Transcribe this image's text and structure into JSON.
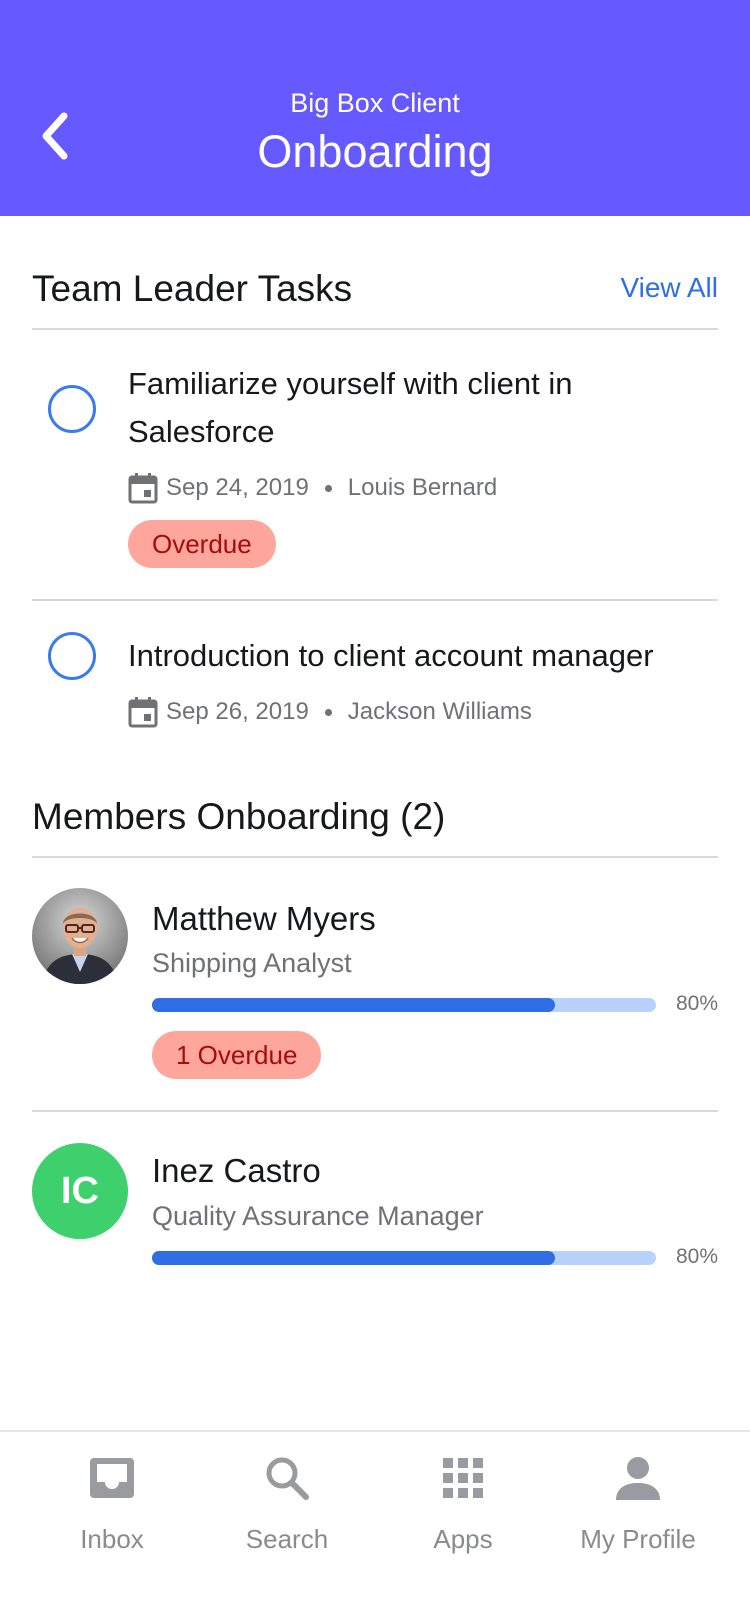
{
  "header": {
    "subtitle": "Big Box Client",
    "title": "Onboarding",
    "back_icon": "chevron-left-icon",
    "background": "#6559ff"
  },
  "tasks_section": {
    "title": "Team Leader Tasks",
    "view_all": "View All",
    "items": [
      {
        "title": "Familiarize yourself with client in Salesforce",
        "date": "Sep 24, 2019",
        "assignee": "Louis Bernard",
        "badge": "Overdue",
        "completed": false
      },
      {
        "title": "Introduction to client account manager",
        "date": "Sep 26, 2019",
        "assignee": "Jackson Williams",
        "completed": false
      }
    ]
  },
  "members_section": {
    "title": "Members Onboarding (2)",
    "members": [
      {
        "name": "Matthew Myers",
        "role": "Shipping Analyst",
        "progress": 0.8,
        "progress_label": "80%",
        "badge": "1 Overdue",
        "avatar": "photo"
      },
      {
        "name": "Inez Castro",
        "role": "Quality Assurance Manager",
        "progress": 0.8,
        "progress_label": "80%",
        "initials": "IC",
        "avatar_color": "#3dd06c"
      }
    ]
  },
  "tabbar": {
    "tabs": [
      {
        "label": "Inbox",
        "icon": "inbox-icon"
      },
      {
        "label": "Search",
        "icon": "search-icon"
      },
      {
        "label": "Apps",
        "icon": "apps-grid-icon"
      },
      {
        "label": "My Profile",
        "icon": "profile-icon"
      }
    ]
  },
  "colors": {
    "accent": "#2f6fe3",
    "overdue_bg": "#fea59c",
    "overdue_text": "#a40d0d"
  }
}
